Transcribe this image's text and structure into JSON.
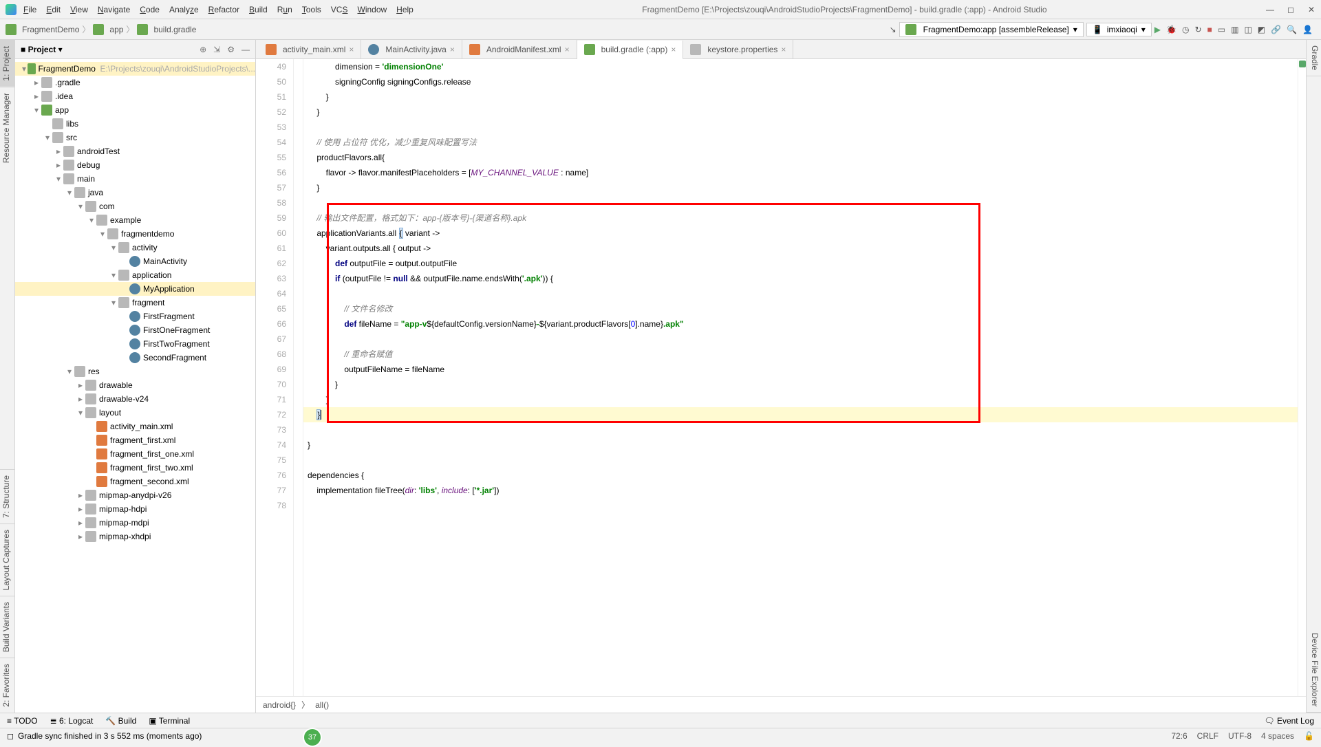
{
  "menu": {
    "items": [
      "File",
      "Edit",
      "View",
      "Navigate",
      "Code",
      "Analyze",
      "Refactor",
      "Build",
      "Run",
      "Tools",
      "VCS",
      "Window",
      "Help"
    ],
    "title": "FragmentDemo [E:\\Projects\\zouqi\\AndroidStudioProjects\\FragmentDemo] - build.gradle (:app) - Android Studio"
  },
  "breadcrumb": [
    "FragmentDemo",
    "app",
    "build.gradle"
  ],
  "run_config": "FragmentDemo:app [assembleRelease]",
  "device": "imxiaoqi",
  "project_tool": "Project",
  "left_tabs": [
    "1: Project",
    "Resource Manager",
    "7: Structure",
    "Layout Captures",
    "Build Variants",
    "2: Favorites"
  ],
  "right_tabs": [
    "Gradle",
    "Device File Explorer"
  ],
  "tree": [
    {
      "d": 0,
      "ic": "mod",
      "tw": "▾",
      "l": "FragmentDemo",
      "dim": "E:\\Projects\\zouqi\\AndroidStudioProjects\\...",
      "sel": true
    },
    {
      "d": 1,
      "ic": "dir",
      "tw": "▸",
      "l": ".gradle"
    },
    {
      "d": 1,
      "ic": "dir",
      "tw": "▸",
      "l": ".idea"
    },
    {
      "d": 1,
      "ic": "mod",
      "tw": "▾",
      "l": "app"
    },
    {
      "d": 2,
      "ic": "dir",
      "tw": "",
      "l": "libs"
    },
    {
      "d": 2,
      "ic": "dir",
      "tw": "▾",
      "l": "src"
    },
    {
      "d": 3,
      "ic": "dir",
      "tw": "▸",
      "l": "androidTest"
    },
    {
      "d": 3,
      "ic": "dir",
      "tw": "▸",
      "l": "debug"
    },
    {
      "d": 3,
      "ic": "dir",
      "tw": "▾",
      "l": "main"
    },
    {
      "d": 4,
      "ic": "dir",
      "tw": "▾",
      "l": "java"
    },
    {
      "d": 5,
      "ic": "dir",
      "tw": "▾",
      "l": "com"
    },
    {
      "d": 6,
      "ic": "dir",
      "tw": "▾",
      "l": "example"
    },
    {
      "d": 7,
      "ic": "dir",
      "tw": "▾",
      "l": "fragmentdemo"
    },
    {
      "d": 8,
      "ic": "dir",
      "tw": "▾",
      "l": "activity"
    },
    {
      "d": 9,
      "ic": "java",
      "tw": "",
      "l": "MainActivity"
    },
    {
      "d": 8,
      "ic": "dir",
      "tw": "▾",
      "l": "application"
    },
    {
      "d": 9,
      "ic": "java",
      "tw": "",
      "l": "MyApplication",
      "sel": true
    },
    {
      "d": 8,
      "ic": "dir",
      "tw": "▾",
      "l": "fragment"
    },
    {
      "d": 9,
      "ic": "java",
      "tw": "",
      "l": "FirstFragment"
    },
    {
      "d": 9,
      "ic": "java",
      "tw": "",
      "l": "FirstOneFragment"
    },
    {
      "d": 9,
      "ic": "java",
      "tw": "",
      "l": "FirstTwoFragment"
    },
    {
      "d": 9,
      "ic": "java",
      "tw": "",
      "l": "SecondFragment"
    },
    {
      "d": 4,
      "ic": "dir",
      "tw": "▾",
      "l": "res"
    },
    {
      "d": 5,
      "ic": "dir",
      "tw": "▸",
      "l": "drawable"
    },
    {
      "d": 5,
      "ic": "dir",
      "tw": "▸",
      "l": "drawable-v24"
    },
    {
      "d": 5,
      "ic": "dir",
      "tw": "▾",
      "l": "layout"
    },
    {
      "d": 6,
      "ic": "xml",
      "tw": "",
      "l": "activity_main.xml"
    },
    {
      "d": 6,
      "ic": "xml",
      "tw": "",
      "l": "fragment_first.xml"
    },
    {
      "d": 6,
      "ic": "xml",
      "tw": "",
      "l": "fragment_first_one.xml"
    },
    {
      "d": 6,
      "ic": "xml",
      "tw": "",
      "l": "fragment_first_two.xml"
    },
    {
      "d": 6,
      "ic": "xml",
      "tw": "",
      "l": "fragment_second.xml"
    },
    {
      "d": 5,
      "ic": "dir",
      "tw": "▸",
      "l": "mipmap-anydpi-v26"
    },
    {
      "d": 5,
      "ic": "dir",
      "tw": "▸",
      "l": "mipmap-hdpi"
    },
    {
      "d": 5,
      "ic": "dir",
      "tw": "▸",
      "l": "mipmap-mdpi"
    },
    {
      "d": 5,
      "ic": "dir",
      "tw": "▸",
      "l": "mipmap-xhdpi"
    }
  ],
  "editor_tabs": [
    {
      "l": "activity_main.xml",
      "ic": "xml"
    },
    {
      "l": "MainActivity.java",
      "ic": "java"
    },
    {
      "l": "AndroidManifest.xml",
      "ic": "xml"
    },
    {
      "l": "build.gradle (:app)",
      "ic": "mod",
      "active": true
    },
    {
      "l": "keystore.properties",
      "ic": "dir"
    }
  ],
  "lines_start": 49,
  "code_crumb": [
    "android{}",
    "all()"
  ],
  "bottom_tabs": [
    "≡ TODO",
    "6: Logcat",
    "Build",
    "Terminal"
  ],
  "event_log": "Event Log",
  "status_msg": "Gradle sync finished in 3 s 552 ms (moments ago)",
  "status_right": [
    "72:6",
    "CRLF",
    "UTF-8",
    "4 spaces"
  ],
  "bubble": "37"
}
